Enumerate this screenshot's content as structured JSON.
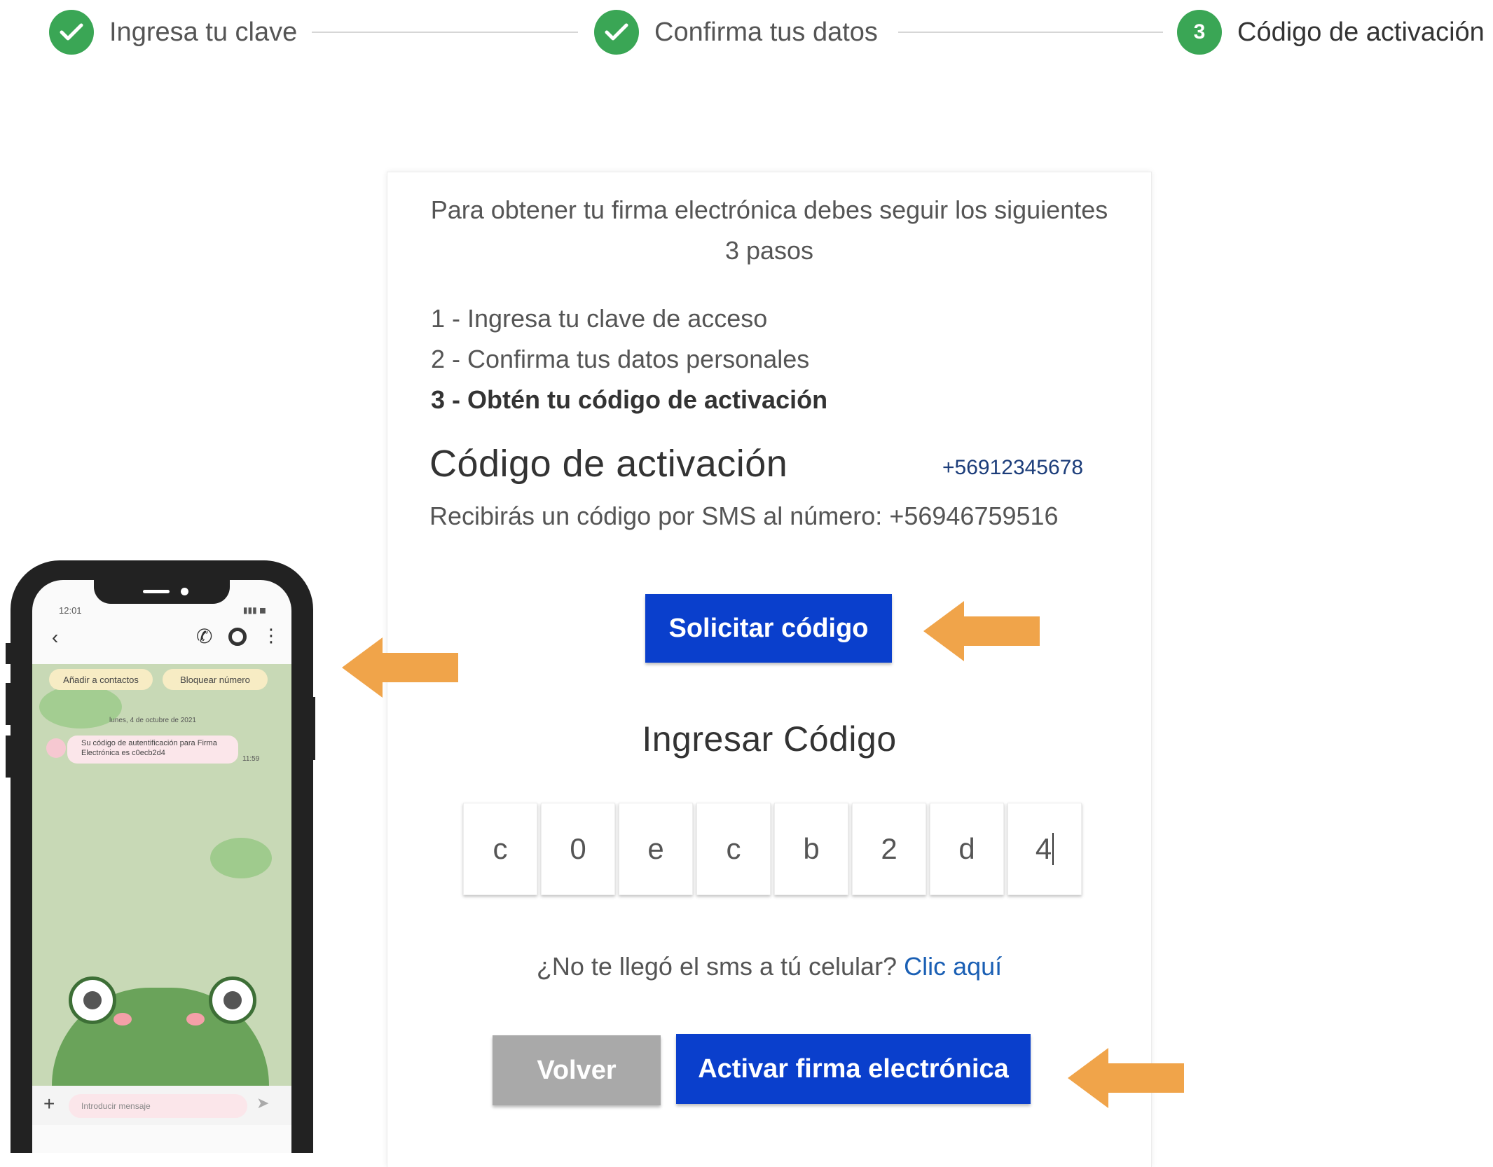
{
  "stepper": {
    "steps": [
      {
        "label": "Ingresa tu clave",
        "state": "done"
      },
      {
        "label": "Confirma tus datos",
        "state": "done"
      },
      {
        "label": "Código de activación",
        "state": "active",
        "number": "3"
      }
    ],
    "done_color": "#3aa655"
  },
  "card": {
    "intro": "Para obtener tu firma electrónica debes seguir los siguientes 3 pasos",
    "step_list": [
      "1 - Ingresa tu clave de acceso",
      "2 - Confirma tus datos personales",
      "3 - Obtén tu código de activación"
    ],
    "code_title": "Código de activación",
    "phone_annotation": "+56912345678",
    "sms_info": "Recibirás un código por SMS al número: +56946759516",
    "request_button": "Solicitar código",
    "enter_title": "Ingresar Código",
    "code_chars": [
      "c",
      "0",
      "e",
      "c",
      "b",
      "2",
      "d",
      "4"
    ],
    "resend_text": "¿No te llegó el sms a tú celular?",
    "resend_link": "Clic aquí",
    "back_button": "Volver",
    "activate_button": "Activar firma electrónica"
  },
  "colors": {
    "primary": "#0a3fcc",
    "disabled": "#a9a9a9",
    "arrow": "#f0a44a",
    "link": "#1a5fb4"
  },
  "phone": {
    "status_time": "12:01",
    "chips": [
      "Añadir a contactos",
      "Bloquear número"
    ],
    "date": "lunes, 4 de octubre de 2021",
    "message": "Su código de autentificación para Firma Electrónica es c0ecb2d4",
    "message_time": "11:59",
    "input_placeholder": "Introducir mensaje"
  }
}
